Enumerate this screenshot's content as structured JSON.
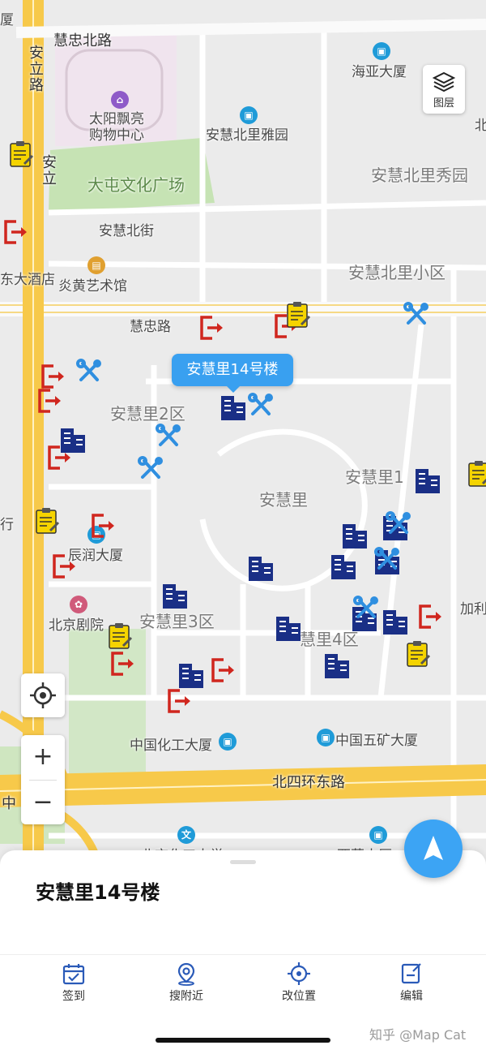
{
  "map": {
    "labels": {
      "huizhong_north_road": "慧忠北路",
      "anli_road": "安立路",
      "anli_road_2": "安立",
      "anli_road_3": "路",
      "haiya": "海亚大厦",
      "taiyang": "太阳飘亮",
      "taiyang2": "购物中心",
      "anhui_north_yayuan": "安慧北里雅园",
      "datun_plaza": "大屯文化广场",
      "anhui_north_xiuyuan": "安慧北里秀园",
      "anhui_north_street": "安慧北街",
      "yanhuang": "炎黄艺术馆",
      "hotel": "东大酒店",
      "anhui_north_xiaoqu": "安慧北里小区",
      "huizhong_road": "慧忠路",
      "anhuili2": "安慧里2区",
      "anhuili1": "安慧里1",
      "anhuili": "安慧里",
      "chenrun": "辰润大厦",
      "beijing_theater": "北京剧院",
      "anhuili3": "安慧里3区",
      "anhuili4": "慧里4区",
      "jiali": "加利",
      "chem_building": "中国化工大厦",
      "minmetals": "中国五矿大厦",
      "north_4th_ring": "北四环东路",
      "zhong": "中",
      "chem_university": "北京化工大学",
      "xiya": "西藏大厦",
      "edge_b": "北",
      "edge_hang": "行",
      "edge_sha": "厦"
    },
    "tooltip": "安慧里14号楼",
    "layer_button_label": "图层",
    "zoom_in_label": "+",
    "zoom_out_label": "−"
  },
  "sheet": {
    "title": "安慧里14号楼"
  },
  "tabs": [
    {
      "label": "签到",
      "icon": "calendar-check-icon"
    },
    {
      "label": "搜附近",
      "icon": "location-pin-icon"
    },
    {
      "label": "改位置",
      "icon": "crosshair-icon"
    },
    {
      "label": "编辑",
      "icon": "edit-icon"
    }
  ],
  "watermark": "知乎 @Map Cat",
  "colors": {
    "accent": "#3ca4f4",
    "building_marker": "#1a2f86",
    "tool_marker": "#2f8fe0",
    "exit_marker": "#d0261e",
    "note_marker": "#f5d400"
  }
}
